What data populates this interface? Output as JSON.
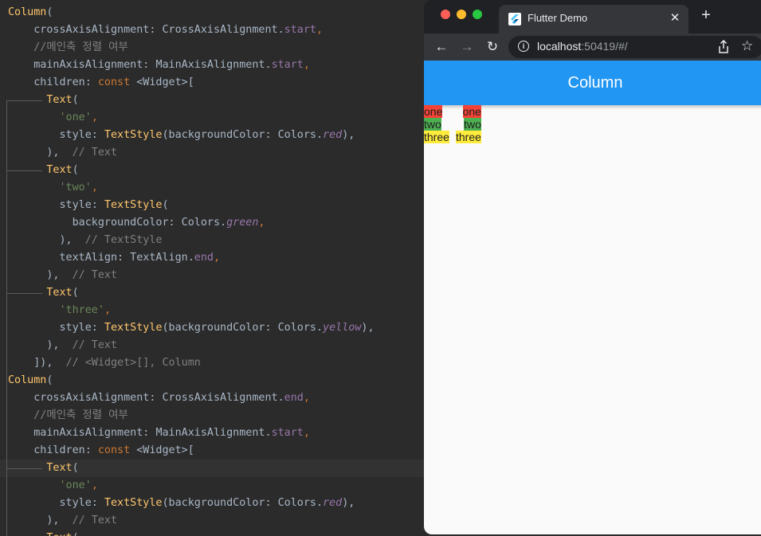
{
  "editor": {
    "lines": [
      [
        {
          "t": "Column",
          "c": "t-fn"
        },
        {
          "t": "(",
          "c": "t-id"
        }
      ],
      [
        {
          "t": "    crossAxisAlignment: ",
          "c": "t-id"
        },
        {
          "t": "CrossAxisAlignment",
          "c": "t-id"
        },
        {
          "t": ".",
          "c": "t-id"
        },
        {
          "t": "start",
          "c": "t-prop"
        },
        {
          "t": ",",
          "c": "t-kw"
        }
      ],
      [
        {
          "t": "    //메인축 정렬 여부",
          "c": "t-cm"
        }
      ],
      [
        {
          "t": "    mainAxisAlignment: ",
          "c": "t-id"
        },
        {
          "t": "MainAxisAlignment",
          "c": "t-id"
        },
        {
          "t": ".",
          "c": "t-id"
        },
        {
          "t": "start",
          "c": "t-prop"
        },
        {
          "t": ",",
          "c": "t-kw"
        }
      ],
      [
        {
          "t": "    children: ",
          "c": "t-id"
        },
        {
          "t": "const ",
          "c": "t-kw"
        },
        {
          "t": "<Widget>[",
          "c": "t-id"
        }
      ],
      [
        {
          "t": "      ",
          "c": "t-id"
        },
        {
          "t": "Text",
          "c": "t-fn"
        },
        {
          "t": "(",
          "c": "t-id"
        }
      ],
      [
        {
          "t": "        ",
          "c": "t-id"
        },
        {
          "t": "'one'",
          "c": "t-str"
        },
        {
          "t": ",",
          "c": "t-kw"
        }
      ],
      [
        {
          "t": "        style: ",
          "c": "t-id"
        },
        {
          "t": "TextStyle",
          "c": "t-fn"
        },
        {
          "t": "(backgroundColor: Colors.",
          "c": "t-id"
        },
        {
          "t": "red",
          "c": "t-prop-i"
        },
        {
          "t": "),",
          "c": "t-id"
        }
      ],
      [
        {
          "t": "      ),  ",
          "c": "t-id"
        },
        {
          "t": "// Text",
          "c": "t-cm"
        }
      ],
      [
        {
          "t": "      ",
          "c": "t-id"
        },
        {
          "t": "Text",
          "c": "t-fn"
        },
        {
          "t": "(",
          "c": "t-id"
        }
      ],
      [
        {
          "t": "        ",
          "c": "t-id"
        },
        {
          "t": "'two'",
          "c": "t-str"
        },
        {
          "t": ",",
          "c": "t-kw"
        }
      ],
      [
        {
          "t": "        style: ",
          "c": "t-id"
        },
        {
          "t": "TextStyle",
          "c": "t-fn"
        },
        {
          "t": "(",
          "c": "t-id"
        }
      ],
      [
        {
          "t": "          backgroundColor: Colors.",
          "c": "t-id"
        },
        {
          "t": "green",
          "c": "t-prop-i"
        },
        {
          "t": ",",
          "c": "t-kw"
        }
      ],
      [
        {
          "t": "        ),  ",
          "c": "t-id"
        },
        {
          "t": "// TextStyle",
          "c": "t-cm"
        }
      ],
      [
        {
          "t": "        textAlign: TextAlign.",
          "c": "t-id"
        },
        {
          "t": "end",
          "c": "t-prop"
        },
        {
          "t": ",",
          "c": "t-kw"
        }
      ],
      [
        {
          "t": "      ),  ",
          "c": "t-id"
        },
        {
          "t": "// Text",
          "c": "t-cm"
        }
      ],
      [
        {
          "t": "      ",
          "c": "t-id"
        },
        {
          "t": "Text",
          "c": "t-fn"
        },
        {
          "t": "(",
          "c": "t-id"
        }
      ],
      [
        {
          "t": "        ",
          "c": "t-id"
        },
        {
          "t": "'three'",
          "c": "t-str"
        },
        {
          "t": ",",
          "c": "t-kw"
        }
      ],
      [
        {
          "t": "        style: ",
          "c": "t-id"
        },
        {
          "t": "TextStyle",
          "c": "t-fn"
        },
        {
          "t": "(backgroundColor: Colors.",
          "c": "t-id"
        },
        {
          "t": "yellow",
          "c": "t-prop-i"
        },
        {
          "t": "),",
          "c": "t-id"
        }
      ],
      [
        {
          "t": "      ),  ",
          "c": "t-id"
        },
        {
          "t": "// Text",
          "c": "t-cm"
        }
      ],
      [
        {
          "t": "    ]),  ",
          "c": "t-id"
        },
        {
          "t": "// <Widget>[], Column",
          "c": "t-cm"
        }
      ],
      [
        {
          "t": "Column",
          "c": "t-fn"
        },
        {
          "t": "(",
          "c": "t-id"
        }
      ],
      [
        {
          "t": "    crossAxisAlignment: ",
          "c": "t-id"
        },
        {
          "t": "CrossAxisAlignment",
          "c": "t-id"
        },
        {
          "t": ".",
          "c": "t-id"
        },
        {
          "t": "end",
          "c": "t-prop"
        },
        {
          "t": ",",
          "c": "t-kw"
        }
      ],
      [
        {
          "t": "    //메인축 정렬 여부",
          "c": "t-cm"
        }
      ],
      [
        {
          "t": "    mainAxisAlignment: ",
          "c": "t-id"
        },
        {
          "t": "MainAxisAlignment",
          "c": "t-id"
        },
        {
          "t": ".",
          "c": "t-id"
        },
        {
          "t": "start",
          "c": "t-prop"
        },
        {
          "t": ",",
          "c": "t-kw"
        }
      ],
      [
        {
          "t": "    children: ",
          "c": "t-id"
        },
        {
          "t": "const ",
          "c": "t-kw"
        },
        {
          "t": "<Widget>[",
          "c": "t-id"
        }
      ],
      [
        {
          "t": "      ",
          "c": "t-id"
        },
        {
          "t": "Text",
          "c": "t-fn"
        },
        {
          "t": "(",
          "c": "t-id"
        }
      ],
      [
        {
          "t": "        ",
          "c": "t-id"
        },
        {
          "t": "'one'",
          "c": "t-str"
        },
        {
          "t": ",",
          "c": "t-kw"
        }
      ],
      [
        {
          "t": "        style: ",
          "c": "t-id"
        },
        {
          "t": "TextStyle",
          "c": "t-fn"
        },
        {
          "t": "(backgroundColor: Colors.",
          "c": "t-id"
        },
        {
          "t": "red",
          "c": "t-prop-i"
        },
        {
          "t": "),",
          "c": "t-id"
        }
      ],
      [
        {
          "t": "      ),  ",
          "c": "t-id"
        },
        {
          "t": "// Text",
          "c": "t-cm"
        }
      ],
      [
        {
          "t": "      ",
          "c": "t-id"
        },
        {
          "t": "Text",
          "c": "t-fn"
        },
        {
          "t": "(",
          "c": "t-id"
        }
      ]
    ]
  },
  "browser": {
    "tab_title": "Flutter Demo",
    "tab_close": "✕",
    "new_tab": "+",
    "url_host": "localhost",
    "url_rest": ":50419/#/",
    "info_glyph": "i",
    "back_glyph": "←",
    "forward_glyph": "→",
    "reload_glyph": "↻",
    "star_glyph": "☆",
    "traffic_lights": [
      "#ff5f57",
      "#febc2e",
      "#28c840"
    ]
  },
  "app": {
    "appbar_title": "Column",
    "appbar_color": "#2196f3",
    "column_start": [
      {
        "text": "one",
        "bg": "#f44336"
      },
      {
        "text": "two",
        "bg": "#4caf50"
      },
      {
        "text": "three",
        "bg": "#ffeb3b"
      }
    ],
    "column_end": [
      {
        "text": "one",
        "bg": "#f44336"
      },
      {
        "text": "two",
        "bg": "#4caf50"
      },
      {
        "text": "three",
        "bg": "#ffeb3b"
      }
    ]
  }
}
